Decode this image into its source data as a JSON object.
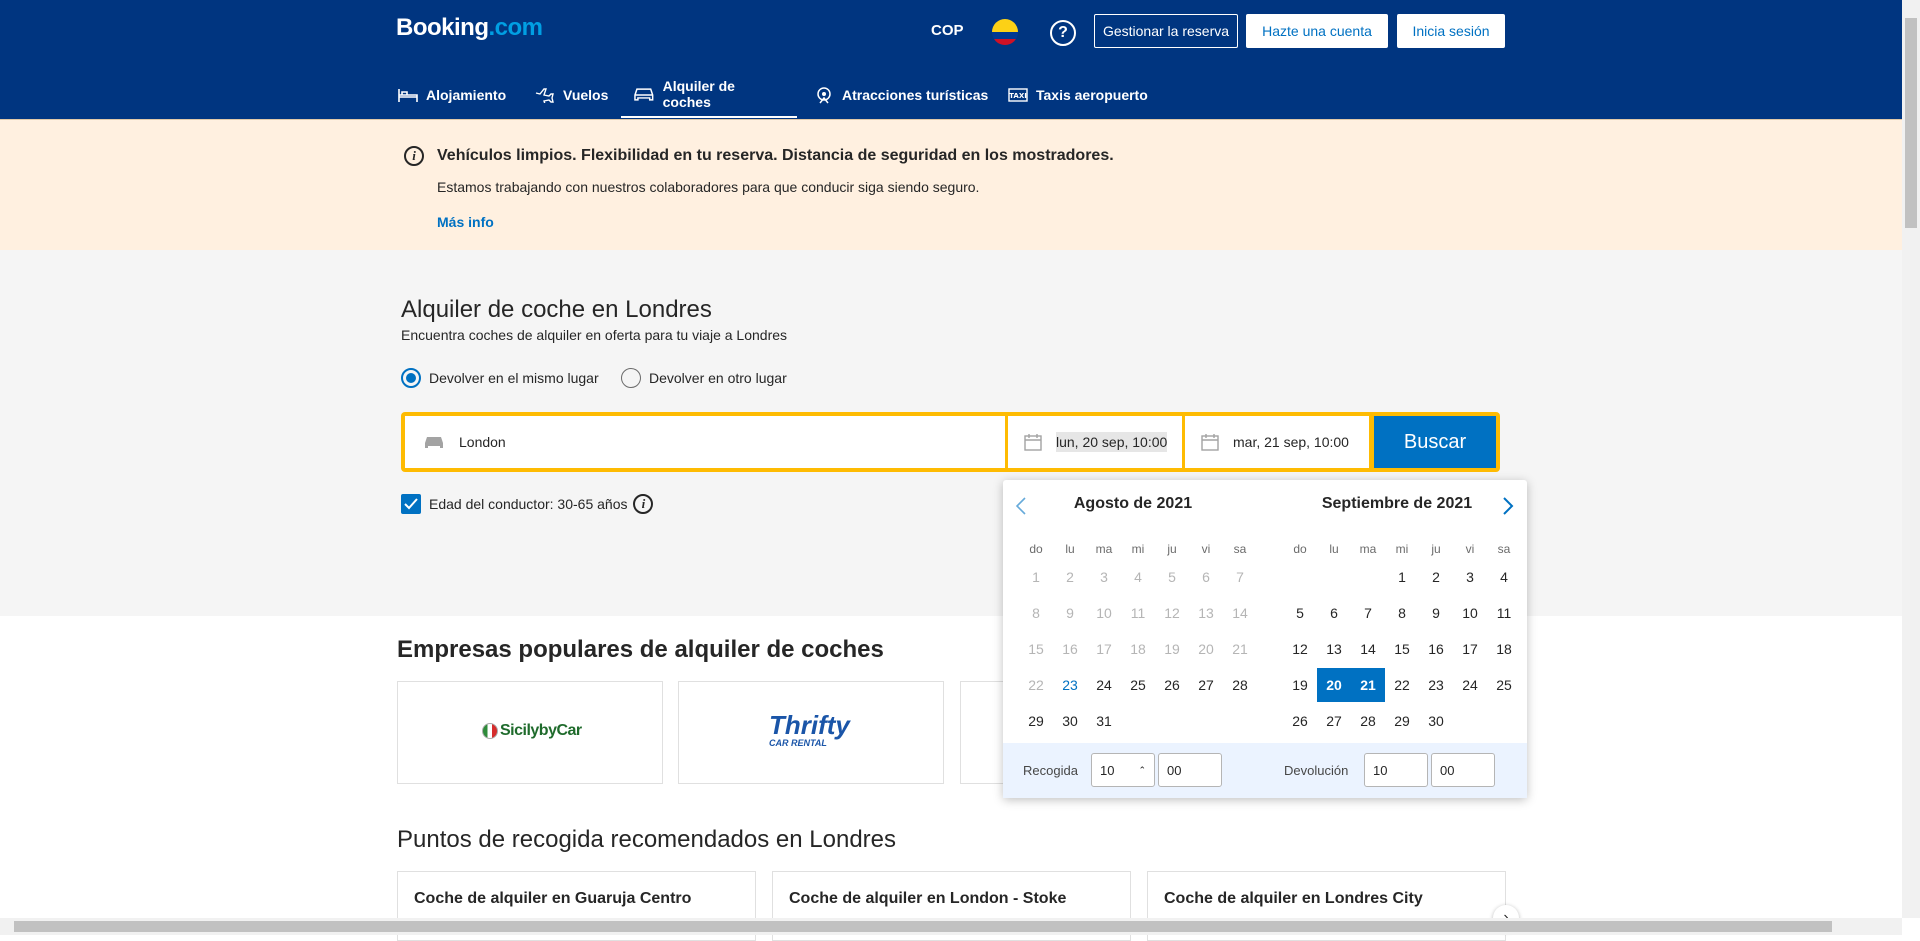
{
  "header": {
    "logo": "Booking",
    "logo_suffix": ".com",
    "currency": "COP",
    "help": "?",
    "manage_booking": "Gestionar la reserva",
    "create_account": "Hazte una cuenta",
    "sign_in": "Inicia sesión"
  },
  "nav": {
    "items": [
      {
        "label": "Alojamiento",
        "icon": "bed-icon"
      },
      {
        "label": "Vuelos",
        "icon": "plane-icon"
      },
      {
        "label": "Alquiler de coches",
        "icon": "car-icon",
        "active": true
      },
      {
        "label": "Atracciones turísticas",
        "icon": "attractions-icon"
      },
      {
        "label": "Taxis aeropuerto",
        "icon": "taxi-icon"
      }
    ]
  },
  "banner": {
    "title": "Vehículos limpios. Flexibilidad en tu reserva. Distancia de seguridad en los mostradores.",
    "text": "Estamos trabajando con nuestros colaboradores para que conducir siga siendo seguro.",
    "link": "Más info"
  },
  "hero": {
    "title": "Alquiler de coche en Londres",
    "subtitle": "Encuentra coches de alquiler en oferta para tu viaje a Londres",
    "radio_same": "Devolver en el mismo lugar",
    "radio_other": "Devolver en otro lugar",
    "location": "London",
    "pickup_date": "lun, 20 sep, 10:00",
    "return_date": "mar, 21 sep, 10:00",
    "search": "Buscar",
    "driver_age": "Edad del conductor: 30-65 años"
  },
  "calendar": {
    "left_month": "Agosto de 2021",
    "right_month": "Septiembre de 2021",
    "weekdays": [
      "do",
      "lu",
      "ma",
      "mi",
      "ju",
      "vi",
      "sa"
    ],
    "today": "23",
    "selected": [
      "20",
      "21"
    ],
    "pickup_label": "Recogida",
    "return_label": "Devolución",
    "pickup_hour": "10",
    "pickup_min": "00",
    "return_hour": "10",
    "return_min": "00"
  },
  "companies": {
    "title": "Empresas populares de alquiler de coches",
    "logo1": "SicilybyCar",
    "logo2": "Thrifty",
    "logo2_sub": "CAR RENTAL"
  },
  "pickups": {
    "title": "Puntos de recogida recomendados en Londres",
    "items": [
      "Coche de alquiler en Guaruja Centro",
      "Coche de alquiler en London - Stoke",
      "Coche de alquiler en Londres City"
    ]
  },
  "colors": {
    "brand": "#003580",
    "accent": "#0071c2",
    "highlight": "#febb02"
  }
}
